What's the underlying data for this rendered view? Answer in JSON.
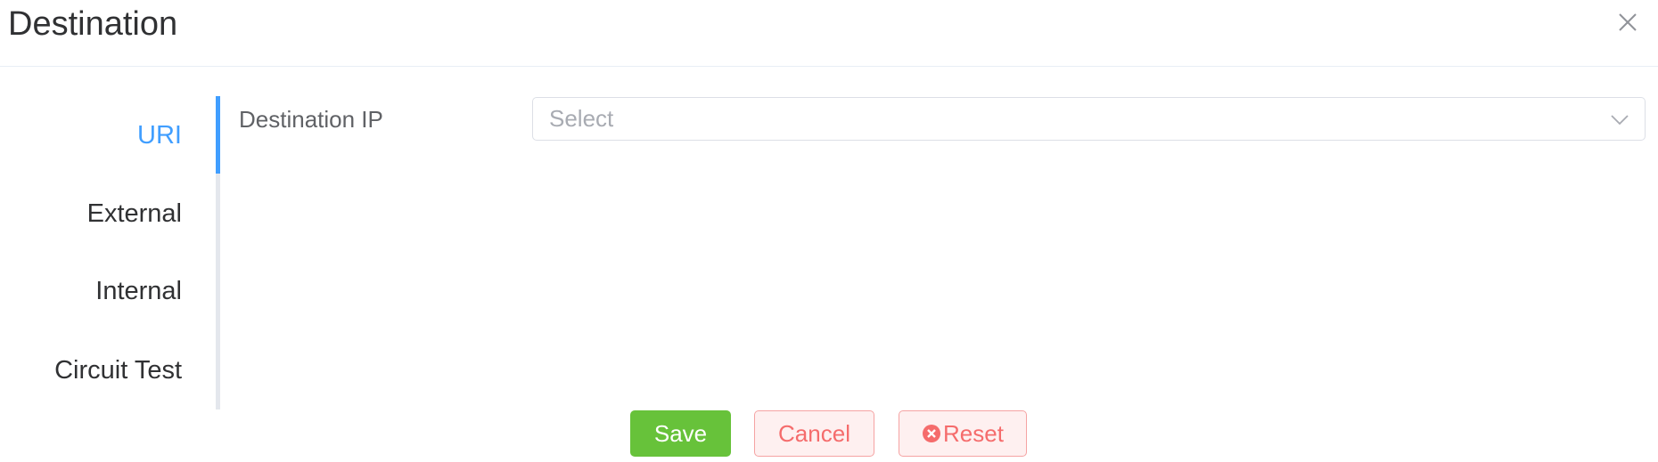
{
  "dialog": {
    "title": "Destination",
    "close_icon": "close-icon"
  },
  "tabs": {
    "items": [
      {
        "label": "URI",
        "active": true
      },
      {
        "label": "External",
        "active": false
      },
      {
        "label": "Internal",
        "active": false
      },
      {
        "label": "Circuit Test",
        "active": false
      }
    ],
    "active_color": "#409eff"
  },
  "form": {
    "destination_ip": {
      "label": "Destination IP",
      "placeholder": "Select",
      "value": "",
      "arrow_icon": "chevron-down-icon"
    }
  },
  "footer": {
    "save_label": "Save",
    "cancel_label": "Cancel",
    "reset_label": "Reset",
    "reset_icon": "circle-close-icon"
  },
  "colors": {
    "primary": "#409eff",
    "success": "#67c23a",
    "danger": "#f56c6c"
  }
}
